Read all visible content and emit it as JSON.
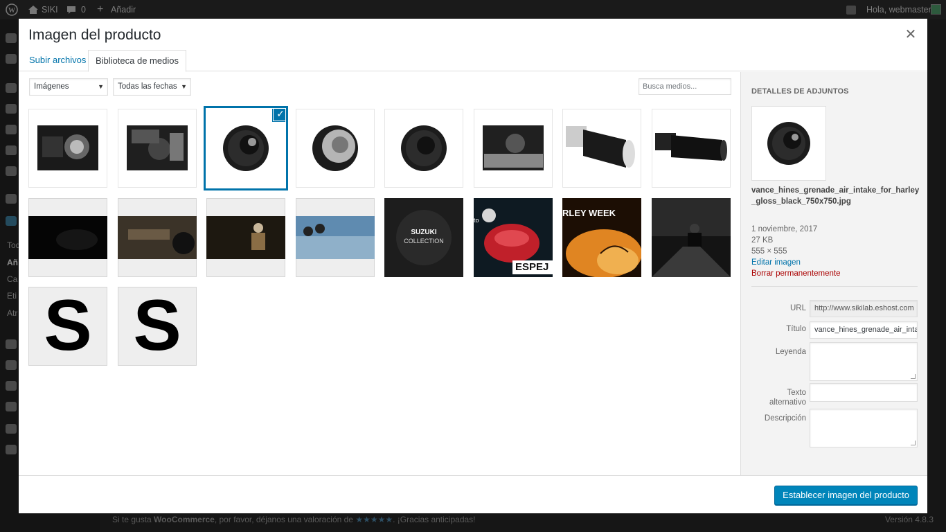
{
  "adminbar": {
    "site_name": "SIKI",
    "comments_count": "0",
    "add_new": "Añadir",
    "greeting": "Hola, webmaster"
  },
  "adminmenu": {
    "items": [
      "Tod",
      "Añ",
      "Ca",
      "Eti",
      "Atr"
    ]
  },
  "footer": {
    "text_before": "Si te gusta ",
    "woocommerce": "WooCommerce",
    "text_middle": ", por favor, déjanos una valoración de ",
    "stars": "★★★★★",
    "text_after": ". ¡Gracias anticipadas!",
    "version": "Versión 4.8.3"
  },
  "modal": {
    "title": "Imagen del producto",
    "close_icon": "close-icon",
    "tabs": [
      {
        "label": "Subir archivos"
      },
      {
        "label": "Biblioteca de medios"
      }
    ],
    "filters": {
      "type": "Imágenes",
      "date": "Todas las fechas",
      "search_placeholder": "Busca medios..."
    },
    "grid": [
      {
        "kind": "engine-photo"
      },
      {
        "kind": "engine-photo"
      },
      {
        "kind": "air-filter-black",
        "selected": true
      },
      {
        "kind": "air-filter-chrome"
      },
      {
        "kind": "air-filter-black"
      },
      {
        "kind": "engine-photo"
      },
      {
        "kind": "cone-filter-chrome"
      },
      {
        "kind": "cone-filter-black"
      },
      {
        "kind": "banner-dark"
      },
      {
        "kind": "banner-bike"
      },
      {
        "kind": "banner-rider"
      },
      {
        "kind": "banner-sky"
      },
      {
        "kind": "suzuki-collection",
        "text_line1": "SUZUKI",
        "text_line2": "COLLECTION"
      },
      {
        "kind": "espejo",
        "text": "ESPEJ",
        "side_text": "to"
      },
      {
        "kind": "harley-week",
        "text": "RLEY WEEK"
      },
      {
        "kind": "rider-night"
      },
      {
        "kind": "letter-s",
        "text": "S"
      },
      {
        "kind": "letter-s",
        "text": "S"
      }
    ],
    "details": {
      "heading": "Detalles de adjuntos",
      "filename": "vance_hines_grenade_air_intake_for_harley_gloss_black_750x750.jpg",
      "date": "1 noviembre, 2017",
      "size": "27 KB",
      "dimensions": "555 × 555",
      "edit_link": "Editar imagen",
      "delete_link": "Borrar permanentemente",
      "fields": {
        "url_label": "URL",
        "url_value": "http://www.sikilab.eshost.com",
        "title_label": "Título",
        "title_value": "vance_hines_grenade_air_intake",
        "caption_label": "Leyenda",
        "alt_label_line1": "Texto",
        "alt_label_line2": "alternativo",
        "description_label": "Descripción"
      }
    },
    "primary_button": "Establecer imagen del producto"
  }
}
